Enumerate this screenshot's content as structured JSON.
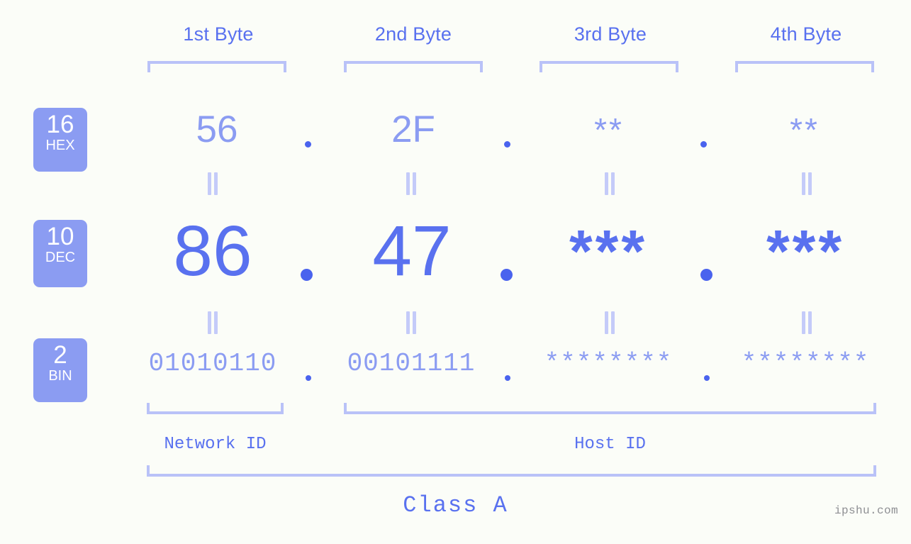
{
  "meta": {
    "background": "#fbfdf8",
    "accent_strong": "#5971ef",
    "accent_mid": "#8b9cf2",
    "accent_light": "#b9c2f8",
    "dot_color": "#4a63ee"
  },
  "byte_headers": [
    {
      "label": "1st Byte"
    },
    {
      "label": "2nd Byte"
    },
    {
      "label": "3rd Byte"
    },
    {
      "label": "4th Byte"
    }
  ],
  "bases": [
    {
      "number": "16",
      "name": "HEX"
    },
    {
      "number": "10",
      "name": "DEC"
    },
    {
      "number": "2",
      "name": "BIN"
    }
  ],
  "rows": {
    "hex": {
      "base_number": "16",
      "base_name": "HEX",
      "values": [
        "56",
        "2F",
        "**",
        "**"
      ],
      "separator": "."
    },
    "dec": {
      "base_number": "10",
      "base_name": "DEC",
      "values": [
        "86",
        "47",
        "***",
        "***"
      ],
      "separator": "."
    },
    "bin": {
      "base_number": "2",
      "base_name": "BIN",
      "values": [
        "01010110",
        "00101111",
        "********",
        "********"
      ],
      "separator": "."
    }
  },
  "equality_marks": {
    "glyph": "=",
    "count_per_row": 4
  },
  "id_sections": [
    {
      "label": "Network ID"
    },
    {
      "label": "Host ID"
    }
  ],
  "class": {
    "label": "Class A"
  },
  "watermark": {
    "text": "ipshu.com"
  }
}
